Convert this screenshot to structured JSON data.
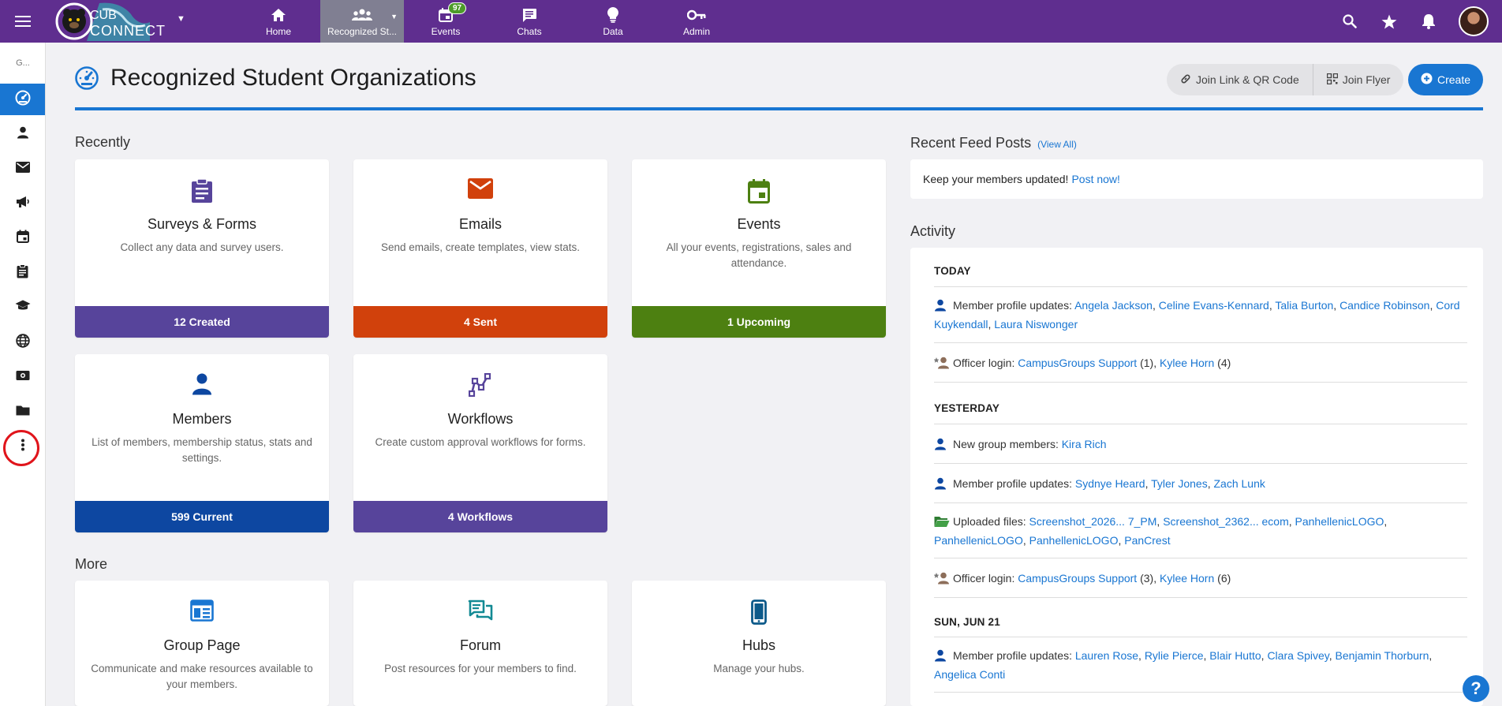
{
  "topbar": {
    "brand_line1": "CUB",
    "brand_line2": "CONNECT",
    "nav": [
      {
        "label": "Home",
        "icon": "home-icon"
      },
      {
        "label": "Recognized St...",
        "icon": "group-icon",
        "active": true
      },
      {
        "label": "Events",
        "icon": "calendar-icon",
        "badge": "97"
      },
      {
        "label": "Chats",
        "icon": "chat-icon"
      },
      {
        "label": "Data",
        "icon": "lightbulb-icon"
      },
      {
        "label": "Admin",
        "icon": "key-icon"
      }
    ],
    "accent": "#5f2e8f",
    "active_nav_bg": "#807f92"
  },
  "sidebar": {
    "top_label": "G...",
    "items": [
      "dashboard-icon",
      "person-icon",
      "mail-icon",
      "megaphone-icon",
      "calendar-icon",
      "clipboard-icon",
      "graduation-icon",
      "globe-icon",
      "money-icon",
      "folder-icon",
      "more-vertical-icon"
    ]
  },
  "page": {
    "title": "Recognized Student Organizations",
    "join_link_label": "Join Link & QR Code",
    "join_flyer_label": "Join Flyer",
    "create_label": "Create"
  },
  "recently": {
    "title": "Recently",
    "cards": [
      {
        "title": "Surveys & Forms",
        "desc": "Collect any data and survey users.",
        "footer": "12 Created",
        "color": "#57449b",
        "icon": "clipboard-icon"
      },
      {
        "title": "Emails",
        "desc": "Send emails, create templates, view stats.",
        "footer": "4 Sent",
        "color": "#d1410c",
        "icon": "mail-icon"
      },
      {
        "title": "Events",
        "desc": "All your events, registrations, sales and attendance.",
        "footer": "1 Upcoming",
        "color": "#4d8011",
        "icon": "calendar-icon"
      },
      {
        "title": "Members",
        "desc": "List of members, membership status, stats and settings.",
        "footer": "599 Current",
        "color": "#0d47a1",
        "icon": "person-icon"
      },
      {
        "title": "Workflows",
        "desc": "Create custom approval workflows for forms.",
        "footer": "4 Workflows",
        "color": "#57449b",
        "icon": "workflow-icon"
      }
    ]
  },
  "more": {
    "title": "More",
    "cards": [
      {
        "title": "Group Page",
        "desc": "Communicate and make resources available to your members.",
        "icon": "web-page-icon"
      },
      {
        "title": "Forum",
        "desc": "Post resources for your members to find.",
        "icon": "forum-icon"
      },
      {
        "title": "Hubs",
        "desc": "Manage your hubs.",
        "icon": "phone-icon"
      }
    ]
  },
  "feed": {
    "title": "Recent Feed Posts",
    "view_all": "(View All)",
    "prompt": "Keep your members updated!",
    "post_now": "Post now!"
  },
  "activity": {
    "title": "Activity",
    "days": [
      {
        "label": "TODAY",
        "rows": [
          {
            "icon": "person-icon",
            "text": "Member profile updates:",
            "links": [
              "Angela Jackson",
              "Celine Evans-Kennard",
              "Talia Burton",
              "Candice Robinson",
              "Cord Kuykendall",
              "Laura Niswonger"
            ]
          },
          {
            "icon": "officer-icon",
            "text": "Officer login:",
            "links": [
              "CampusGroups Support",
              "Kylee Horn"
            ],
            "counts": [
              "(1)",
              "(4)"
            ]
          }
        ]
      },
      {
        "label": "YESTERDAY",
        "rows": [
          {
            "icon": "person-icon",
            "text": "New group members:",
            "links": [
              "Kira Rich"
            ]
          },
          {
            "icon": "person-icon",
            "text": "Member profile updates:",
            "links": [
              "Sydnye Heard",
              "Tyler Jones",
              "Zach Lunk"
            ]
          },
          {
            "icon": "folder-open-icon",
            "text": "Uploaded files:",
            "links": [
              "Screenshot_2026... 7_PM",
              "Screenshot_2362... ecom",
              "PanhellenicLOGO",
              "PanhellenicLOGO",
              "PanhellenicLOGO",
              "PanCrest"
            ]
          },
          {
            "icon": "officer-icon",
            "text": "Officer login:",
            "links": [
              "CampusGroups Support",
              "Kylee Horn"
            ],
            "counts": [
              "(3)",
              "(6)"
            ]
          }
        ]
      },
      {
        "label": "SUN, JUN 21",
        "rows": [
          {
            "icon": "person-icon",
            "text": "Member profile updates:",
            "links": [
              "Lauren Rose",
              "Rylie Pierce",
              "Blair Hutto",
              "Clara Spivey",
              "Benjamin Thorburn",
              "Angelica Conti"
            ]
          }
        ]
      }
    ]
  },
  "help_label": "?"
}
